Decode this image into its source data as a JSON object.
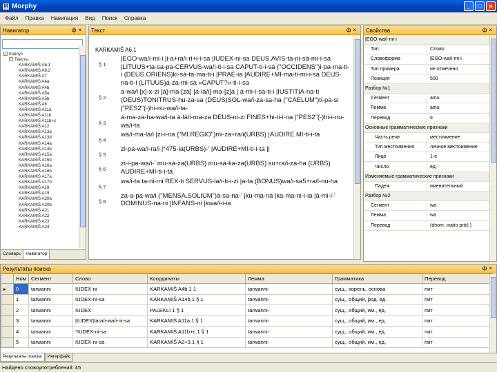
{
  "window": {
    "title": "Morphy"
  },
  "menu": [
    "Файл",
    "Правка",
    "Навигация",
    "Вид",
    "Поиск",
    "Справка"
  ],
  "navigator": {
    "title": "Навигатор",
    "search_value": "",
    "tree": [
      {
        "level": 0,
        "label": "Корпус",
        "expanded": true
      },
      {
        "level": 1,
        "label": "Тексты",
        "expanded": true
      },
      {
        "level": 2,
        "label": "KARKAMIŠ A6.1"
      },
      {
        "level": 2,
        "label": "KARKAMIŠ A6.2"
      },
      {
        "level": 2,
        "label": "KARKAMIŠ A7"
      },
      {
        "level": 2,
        "label": "KARKAMIŠ A4a"
      },
      {
        "level": 2,
        "label": "KARKAMIŠ A4b"
      },
      {
        "level": 2,
        "label": "KARKAMIŠ A5a"
      },
      {
        "level": 2,
        "label": "KARKAMIŠ A5b"
      },
      {
        "level": 2,
        "label": "KARKAMIŠ A6"
      },
      {
        "level": 2,
        "label": "KARKAMIŠ A11a"
      },
      {
        "level": 2,
        "label": "KARKAMIŠ A11b"
      },
      {
        "level": 2,
        "label": "KARKAMIŠ A11b+c"
      },
      {
        "level": 2,
        "label": "KARKAMIŠ A12"
      },
      {
        "level": 2,
        "label": "KARKAMIŠ A13a"
      },
      {
        "level": 2,
        "label": "KARKAMIŠ A13d"
      },
      {
        "level": 2,
        "label": "KARKAMIŠ A14a"
      },
      {
        "level": 2,
        "label": "KARKAMIŠ A14b"
      },
      {
        "level": 2,
        "label": "KARKAMIŠ A15a"
      },
      {
        "level": 2,
        "label": "KARKAMIŠ A15b"
      },
      {
        "level": 2,
        "label": "KARKAMIŠ A16a"
      },
      {
        "level": 2,
        "label": "KARKAMIŠ A16b"
      },
      {
        "level": 2,
        "label": "KARKAMIŠ A17a"
      },
      {
        "level": 2,
        "label": "KARKAMIŠ A17b"
      },
      {
        "level": 2,
        "label": "KARKAMIŠ A18"
      },
      {
        "level": 2,
        "label": "KARKAMIŠ A19"
      },
      {
        "level": 2,
        "label": "KARKAMIŠ A20a"
      },
      {
        "level": 2,
        "label": "KARKAMIŠ A20b"
      },
      {
        "level": 2,
        "label": "KARKAMIŠ A21"
      },
      {
        "level": 2,
        "label": "KARKAMIŠ A22"
      },
      {
        "level": 2,
        "label": "KARKAMIŠ A23"
      },
      {
        "level": 2,
        "label": "KARKAMIŠ A24"
      }
    ],
    "tabs": [
      "Словарь",
      "Навигатор"
    ]
  },
  "text": {
    "title": "Текст",
    "document_title": "KARKAMIŠ A6.1",
    "rows": [
      {
        "ln": "§ 1",
        "text": "|EGO-wa/i-mi-i |i-a+ra/i-ri+i-i-sa |IUDEX-ni-sa DEUS.AVIS-ta-ni-sà-mi-i-sa |LITUUS+ta-sa-pa-CERVUS-wa/i-ti-i-sa CAPUT-ti-i-sá (\"OCCIDENS\")i-pa-ma-ti-i (DEUS.ORIENS)ki-sà-ta-ma-ti-i |PRAE-ia |AUDIRE+MI-ma-ti-mi-i-sa DEUS-na-ti-i (LITUUS)á-za-mi-sa «CAPUT?»-ti-i-sa"
      },
      {
        "ln": "§ 2",
        "text": "a-wa/i [x]-x-zi [á]-ma-[za] [á-là/i]-ma-[z]a | á-mi-i-sa-ti-i |IUSTITIA-na-ti (DEUS)TONITRUS-hu-za-sa (DEUS)SOL-wa/i-za-sa-ha (\"CAELUM\")ti-pa-si |\"PES2\"(-)hi-nu-wa/i-ta-"
      },
      {
        "ln": "§ 3",
        "text": "á-ma-za-ha-wa/i-ta á-là/i-ma-za DEUS-ni-zi FINES+hi-ti-i-na |\"PES2\"(-)hi-i-nu-wa/i-ta"
      },
      {
        "ln": "§ 4",
        "text": "wa/i-ma-là/i |zi-i-na (\"MI.REGIO\")mi-za+ra/i(URBS) |AUDIRE.MI-ti-i-ta"
      },
      {
        "ln": "§ 5",
        "text": "zi-pa-wa/i-ra/i |*475-la(URBS)-' |AUDIRE+MI-ti-i-ta ||"
      },
      {
        "ln": "§ 6",
        "text": "zi-i-pa-wa/i-' mu-sà-za(URBS) mu-sà-ka-za(URBS) su+ra/i-za-ha (URBS) AUDIRE+MI-ti-i-ta"
      },
      {
        "ln": "§ 7",
        "text": "wa/i-ta ta-ni-mi REX-ti SERVUS-la/i-ti-i-zi |a-ta (BONUS)wa/i-sa5+ra/i-nu-ha"
      },
      {
        "ln": "§ 8",
        "text": "za-a-pa-wa/i (\"MENSA.SOLIUM\")á-sa-na-' |ku-ma-na |ka-ma-ni-i-ia |à-mi-i-' DOMINUS-na-ni |INFANS-ni |kwa/i-i-ia"
      }
    ]
  },
  "properties": {
    "title": "Свойства",
    "header_value": "|EGO-wa/i-mi-i",
    "rows": [
      {
        "type": "prop",
        "key": "Тип",
        "value": "Слово"
      },
      {
        "type": "prop",
        "key": "Словоформа",
        "value": "|EGO-wa/i-mi-i"
      },
      {
        "type": "prop",
        "key": "Тип примера",
        "value": "не отмечено"
      },
      {
        "type": "prop",
        "key": "Позиция",
        "value": "500"
      },
      {
        "type": "cat",
        "key": "Разбор №1",
        "value": ""
      },
      {
        "type": "prop",
        "key": "Сегмент",
        "value": "amu"
      },
      {
        "type": "prop",
        "key": "Лемма",
        "value": "amu"
      },
      {
        "type": "prop",
        "key": "Перевод",
        "value": "я"
      },
      {
        "type": "cat",
        "key": "Основные грамматические признаки",
        "value": ""
      },
      {
        "type": "sub",
        "key": "Часть речи",
        "value": "местоимение"
      },
      {
        "type": "sub",
        "key": "Тип местоимения",
        "value": "личное местоимение"
      },
      {
        "type": "sub",
        "key": "Лицо",
        "value": "1-е"
      },
      {
        "type": "sub",
        "key": "Число",
        "value": "ед."
      },
      {
        "type": "cat",
        "key": "Изменяемые грамматические признаки",
        "value": ""
      },
      {
        "type": "sub",
        "key": "Падеж",
        "value": "именительный"
      },
      {
        "type": "cat",
        "key": "Разбор №2",
        "value": ""
      },
      {
        "type": "prop",
        "key": "Сегмент",
        "value": "wa"
      },
      {
        "type": "prop",
        "key": "Лемма",
        "value": "wa"
      },
      {
        "type": "prop",
        "key": "Перевод",
        "value": "(dnom. inatio prtcl.)"
      }
    ]
  },
  "results": {
    "title": "Результаты поиска",
    "columns": [
      "Ном",
      "Сегмент",
      "Слово",
      "Координаты",
      "Лемма",
      "Грамматика",
      "Перевод"
    ],
    "rows": [
      {
        "num": "0",
        "segment": "tarwanni",
        "word": "IUDEX-ni",
        "coords": "KARKAMIŠ A4b.1 1",
        "lemma": "tarwanni-",
        "grammar": "сущ., корень, основа",
        "translation": "пит"
      },
      {
        "num": "1",
        "segment": "tarwanni",
        "word": "IUDEX-ni-sa",
        "coords": "KARKAMIŠ A14b.1 § 1",
        "lemma": "tarwanni-",
        "grammar": "сущ., общий, род. ед.",
        "translation": "пит"
      },
      {
        "num": "2",
        "segment": "tarwanni",
        "word": "IUDEX",
        "coords": "PALEKLI 1 § 1",
        "lemma": "tarwanni-",
        "grammar": "сущ., общий, им., ед.",
        "translation": "пит"
      },
      {
        "num": "3",
        "segment": "tarwanni",
        "word": "|IUDEX|tara/i-wa/i-ni-sa",
        "coords": "KARKAMIŠ A11a.1 § 1",
        "lemma": "tarwanni-",
        "grammar": "сущ., общий, им., ед.",
        "translation": "пит"
      },
      {
        "num": "4",
        "segment": "tarwanni",
        "word": "*IUDEX-ni-sa",
        "coords": "KARKAMIŠ A11b+c.1 § 1",
        "lemma": "tarwanni-",
        "grammar": "сущ., общий, им., ед.",
        "translation": "пит"
      },
      {
        "num": "5",
        "segment": "tarwanni",
        "word": "IUDEX-ni-sa",
        "coords": "KARKAMIŠ A2+3.1 § 1",
        "lemma": "tarwanni-",
        "grammar": "сущ., общий, им., ед.",
        "translation": "пит"
      }
    ]
  },
  "bottom_tabs": [
    "Результаты поиска",
    "Ингерфайс"
  ],
  "status": "Найдено словоупотреблений: 45"
}
